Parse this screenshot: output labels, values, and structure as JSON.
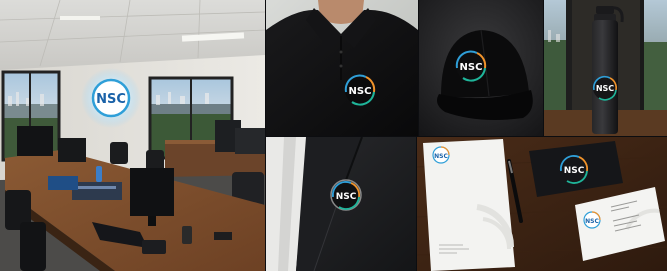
{
  "brand": {
    "logo_text": "NSC",
    "colors": {
      "ring_blue": "#2f9fd8",
      "ring_teal": "#1fb59a",
      "ring_orange": "#f0932b",
      "ring_glow": "#8fd4ff"
    }
  },
  "panels": [
    {
      "id": "office",
      "subject": "office interior with illuminated NSC logo sign"
    },
    {
      "id": "polo",
      "subject": "black polo shirt with NSC embroidered logo"
    },
    {
      "id": "cap",
      "subject": "black cap with NSC logo"
    },
    {
      "id": "bottle",
      "subject": "black water bottle with NSC logo"
    },
    {
      "id": "pin",
      "subject": "blazer lapel pin with NSC logo"
    },
    {
      "id": "stationery",
      "subject": "letterhead, pen and business cards with NSC logo"
    }
  ]
}
